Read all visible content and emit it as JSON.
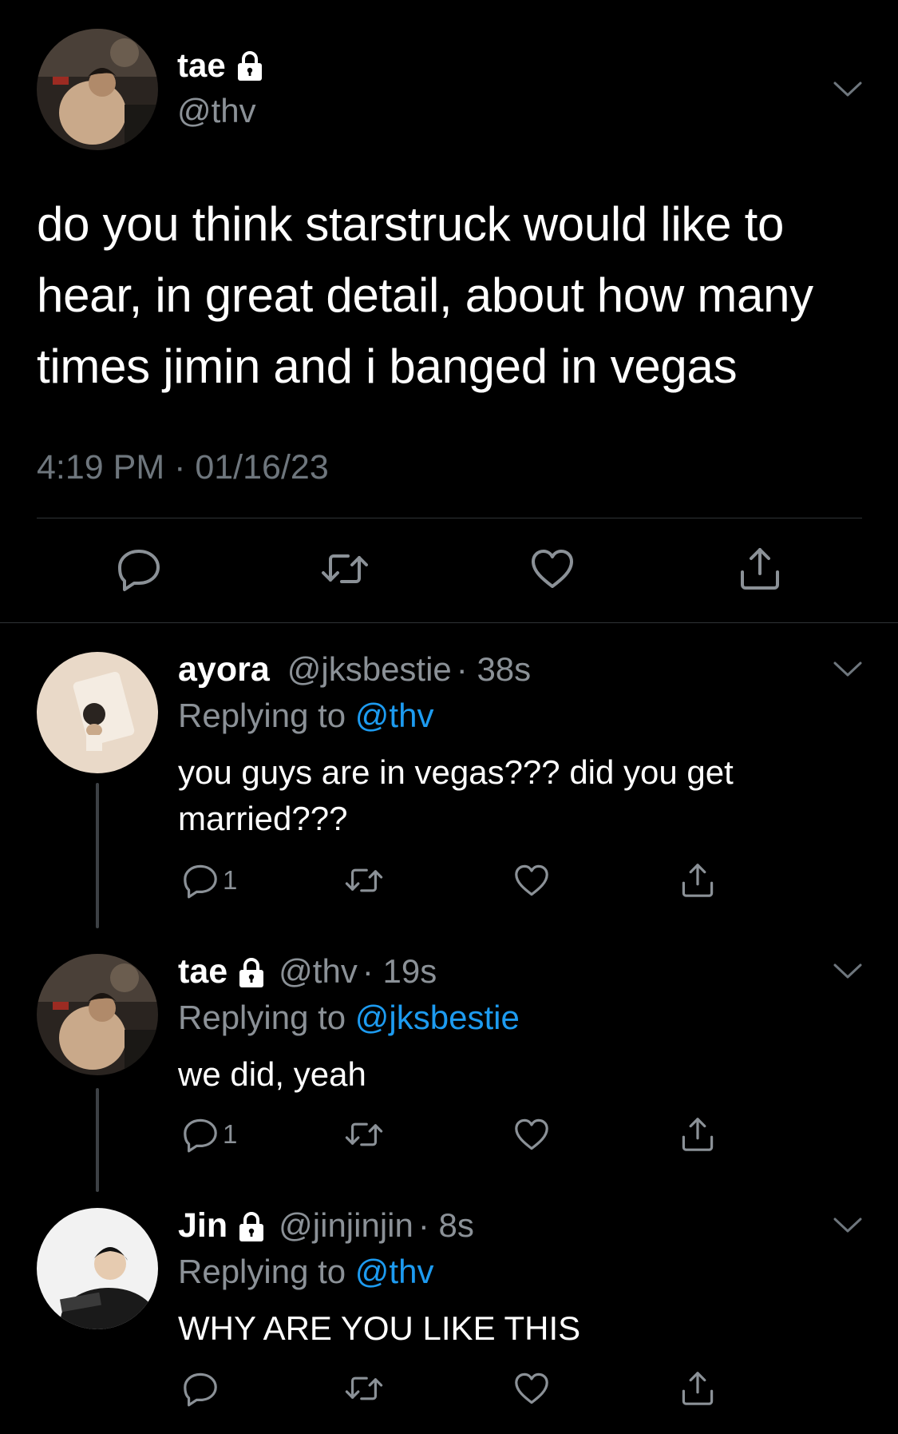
{
  "main_tweet": {
    "name": "tae",
    "handle": "@thv",
    "text": "do you think starstruck would like to hear, in great detail, about how many times jimin and i banged in vegas",
    "timestamp": "4:19 PM · 01/16/23",
    "actions": [
      "reply-icon",
      "retweet-icon",
      "like-icon",
      "share-icon"
    ]
  },
  "replies": [
    {
      "name": "ayora",
      "handle": "@jksbestie",
      "age": "· 38s",
      "replying_label": "Replying to",
      "replying_to": "@thv",
      "text": "you guys are in vegas??? did you get married???",
      "reply_count": "1"
    },
    {
      "name": "tae",
      "handle": "@thv",
      "age": "· 19s",
      "replying_label": "Replying to",
      "replying_to": "@jksbestie",
      "text": "we did, yeah",
      "reply_count": "1"
    },
    {
      "name": "Jin",
      "handle": "@jinjinjin",
      "age": "· 8s",
      "replying_label": "Replying to",
      "replying_to": "@thv",
      "text": "WHY ARE YOU LIKE THIS",
      "reply_count": ""
    }
  ],
  "colors": {
    "background": "#000000",
    "secondary_text": "#8b9197",
    "link": "#1d9bf0",
    "divider": "#2f3336"
  }
}
